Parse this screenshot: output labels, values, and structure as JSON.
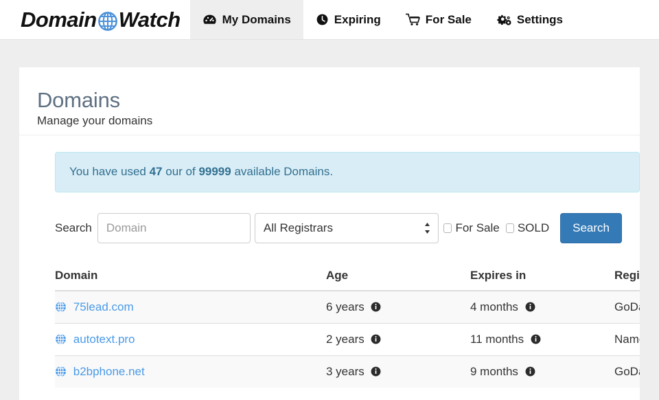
{
  "brand": {
    "text_before": "Domain",
    "text_after": "Watch",
    "globe_icon": "globe-icon"
  },
  "nav": {
    "items": [
      {
        "label": "My Domains",
        "icon": "tachometer-icon",
        "active": true
      },
      {
        "label": "Expiring",
        "icon": "clock-icon",
        "active": false
      },
      {
        "label": "For Sale",
        "icon": "shopping-cart-icon",
        "active": false
      },
      {
        "label": "Settings",
        "icon": "gears-icon",
        "active": false
      }
    ]
  },
  "header": {
    "title": "Domains",
    "subtitle": "Manage your domains"
  },
  "alert": {
    "prefix": "You have used ",
    "used": "47",
    "middle": " our of ",
    "total": "99999",
    "suffix": " available Domains."
  },
  "search": {
    "label": "Search",
    "domain_placeholder": "Domain",
    "domain_value": "",
    "registrar_selected": "All Registrars",
    "registrar_options": [
      "All Registrars"
    ],
    "for_sale_label": "For Sale",
    "for_sale_checked": false,
    "sold_label": "SOLD",
    "sold_checked": false,
    "button_label": "Search"
  },
  "table": {
    "columns": [
      "Domain",
      "Age",
      "Expires in",
      "Registrar"
    ],
    "rows": [
      {
        "domain": "75lead.com",
        "age": "6 years",
        "expires": "4 months",
        "registrar": "GoDaddy.com"
      },
      {
        "domain": "autotext.pro",
        "age": "2 years",
        "expires": "11 months",
        "registrar": "NameCheap"
      },
      {
        "domain": "b2bphone.net",
        "age": "3 years",
        "expires": "9 months",
        "registrar": "GoDaddy.com"
      }
    ],
    "row_icon": "globe-icon",
    "info_icon": "info-circle-icon"
  },
  "colors": {
    "accent_blue": "#337ab7",
    "link_blue": "#4a9ae8",
    "alert_bg": "#d9edf7",
    "alert_border": "#bce8f1",
    "alert_text": "#31708f",
    "title_gray": "#5f7082",
    "page_bg": "#eeeeee"
  }
}
